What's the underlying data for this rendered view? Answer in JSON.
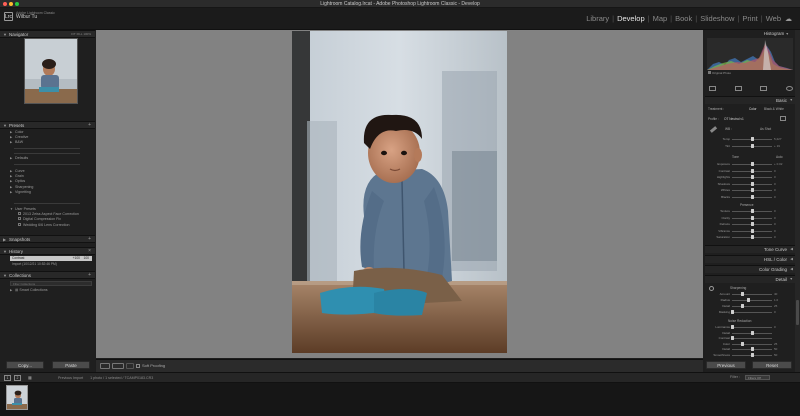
{
  "titlebar": {
    "title": "Lightroom Catalog.lrcat - Adobe Photoshop Lightroom Classic - Develop"
  },
  "identity": {
    "app": "Adobe Lightroom Classic",
    "user": "Wilbur Tu",
    "logo": "Lrc"
  },
  "modules": [
    "Library",
    "Develop",
    "Map",
    "Book",
    "Slideshow",
    "Print",
    "Web"
  ],
  "active_module": "Develop",
  "left_panel": {
    "navigator": {
      "title": "Navigator",
      "zoom": [
        "FIT",
        "FILL",
        "100%"
      ]
    },
    "presets": {
      "title": "Presets",
      "groups_top": [
        "Color",
        "Creative",
        "B&W"
      ],
      "groups_mid": [
        "Defaults"
      ],
      "groups_bot": [
        "Curve",
        "Grain",
        "Optics",
        "Sharpening",
        "Vignetting"
      ],
      "user_presets": {
        "name": "User Presets",
        "items": [
          "2013 Zeiss Aspect Face Correction",
          "Digital Compression Fix",
          "Wedding 6/6 Lens Correction"
        ]
      }
    },
    "snapshots": {
      "title": "Snapshots"
    },
    "history": {
      "title": "History",
      "rows": [
        {
          "label": "Contrast",
          "a": "+100",
          "b": "100"
        },
        {
          "label": "Import (10/12/21 10:52:46 PM)",
          "a": "",
          "b": ""
        }
      ]
    },
    "collections": {
      "title": "Collections",
      "filter": "Filter Collections",
      "items": [
        "Smart Collections"
      ]
    },
    "buttons": {
      "copy": "Copy...",
      "paste": "Paste"
    }
  },
  "toolbar": {
    "soft_proofing": "Soft Proofing"
  },
  "right_panel": {
    "histogram": {
      "title": "Histogram",
      "original_photo": "Original Photo"
    },
    "basic": {
      "title": "Basic",
      "treatment_label": "Treatment :",
      "treatment_color": "Color",
      "treatment_bw": "Black & White",
      "profile_label": "Profile :",
      "profile_value": "OT Neutral v1",
      "wb_label": "WB :",
      "wb_value": "As Shot",
      "temp_tint": [
        {
          "label": "Temp",
          "value": "5,227"
        },
        {
          "label": "Tint",
          "value": "+ 19"
        }
      ],
      "tone_label": "Tone",
      "auto_label": "Auto",
      "tone_sliders": [
        {
          "label": "Exposure",
          "value": "+ 0.02",
          "pos": 0.52
        },
        {
          "label": "Contrast",
          "value": "0",
          "pos": 0.5
        },
        {
          "label": "Highlights",
          "value": "0",
          "pos": 0.5
        },
        {
          "label": "Shadows",
          "value": "0",
          "pos": 0.5
        },
        {
          "label": "Whites",
          "value": "0",
          "pos": 0.5
        },
        {
          "label": "Blacks",
          "value": "0",
          "pos": 0.5
        }
      ],
      "presence_label": "Presence",
      "presence_sliders": [
        {
          "label": "Texture",
          "value": "0",
          "pos": 0.5
        },
        {
          "label": "Clarity",
          "value": "0",
          "pos": 0.5
        },
        {
          "label": "Dehaze",
          "value": "0",
          "pos": 0.5
        },
        {
          "label": "Vibrance",
          "value": "0",
          "pos": 0.5
        },
        {
          "label": "Saturation",
          "value": "0",
          "pos": 0.5
        }
      ]
    },
    "collapsed_sections": [
      "Tone Curve",
      "HSL / Color",
      "Color Grading"
    ],
    "detail": {
      "title": "Detail",
      "sharpening_label": "Sharpening",
      "sharpening": [
        {
          "label": "Amount",
          "value": "40",
          "pos": 0.27
        },
        {
          "label": "Radius",
          "value": "1.0",
          "pos": 0.4
        },
        {
          "label": "Detail",
          "value": "25",
          "pos": 0.25
        },
        {
          "label": "Masking",
          "value": "0",
          "pos": 0.0
        }
      ],
      "nr_label": "Noise Reduction",
      "nr": [
        {
          "label": "Luminance",
          "value": "0",
          "pos": 0.0
        },
        {
          "label": "Detail",
          "value": "",
          "pos": 0.5
        },
        {
          "label": "Contrast",
          "value": "",
          "pos": 0.0
        },
        {
          "label": "Color",
          "value": "25",
          "pos": 0.25
        },
        {
          "label": "Detail",
          "value": "50",
          "pos": 0.5
        },
        {
          "label": "Smoothness",
          "value": "50",
          "pos": 0.5
        }
      ]
    },
    "buttons": {
      "previous": "Previous",
      "reset": "Reset"
    }
  },
  "filmstrip": {
    "source": "Previous Import",
    "path": "1 photo / 1 selected / TCAMP0183.CR3",
    "filter_label": "Filter :",
    "filter_value": "Filters Off"
  }
}
